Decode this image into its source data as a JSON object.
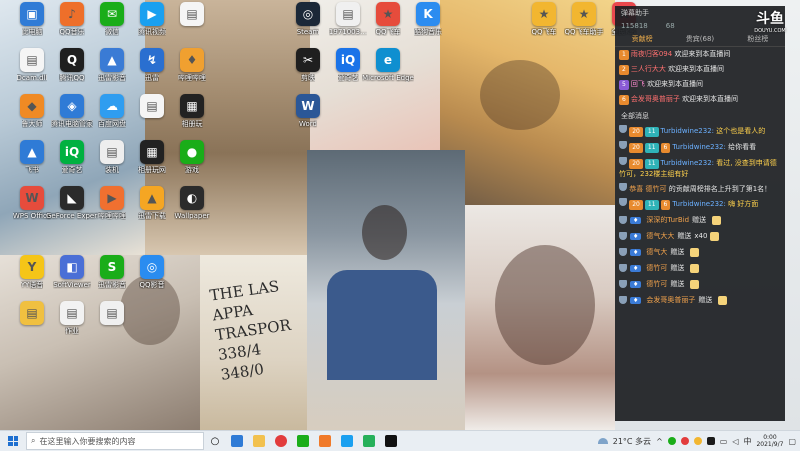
{
  "desktop": {
    "icons": [
      {
        "id": "d1",
        "label": "此电脑",
        "color": "#2f7bd6",
        "glyph": "▣"
      },
      {
        "id": "d2",
        "label": "QQ音乐",
        "color": "#ee6f2a",
        "glyph": "♪"
      },
      {
        "id": "d3",
        "label": "微信",
        "color": "#1aad19",
        "glyph": "✉"
      },
      {
        "id": "d4",
        "label": "腾讯视频",
        "color": "#1aa0f0",
        "glyph": "▶"
      },
      {
        "id": "d5",
        "label": "",
        "color": "#f5f5f5",
        "glyph": "▤"
      },
      {
        "id": "d6",
        "label": "Steam",
        "color": "#1b2838",
        "glyph": "◎"
      },
      {
        "id": "d7",
        "label": "1971003…",
        "color": "#f0f0f0",
        "glyph": "▤"
      },
      {
        "id": "d8",
        "label": "QQ飞车",
        "color": "#e64c3c",
        "glyph": "★"
      },
      {
        "id": "d9",
        "label": "酷狗音乐",
        "color": "#2c8cf0",
        "glyph": "K"
      },
      {
        "id": "d10",
        "label": "QQ飞车",
        "color": "#f2b630",
        "glyph": "★"
      },
      {
        "id": "d11",
        "label": "QQ飞车助手",
        "color": "#f2b630",
        "glyph": "★"
      },
      {
        "id": "d12",
        "label": "全民K歌",
        "color": "#e9484d",
        "glyph": "K"
      },
      {
        "id": "d13",
        "label": "Dcam.dll",
        "color": "#f5f5f5",
        "glyph": "▤"
      },
      {
        "id": "d14",
        "label": "腾讯QQ",
        "color": "#1f1f1f",
        "glyph": "Q"
      },
      {
        "id": "d15",
        "label": "迅雷影音",
        "color": "#3a7bd5",
        "glyph": "▲"
      },
      {
        "id": "d16",
        "label": "迅雷",
        "color": "#2a6fd0",
        "glyph": "↯"
      },
      {
        "id": "d17",
        "label": "哔哩哔哩",
        "color": "#f0a030",
        "glyph": "♦"
      },
      {
        "id": "d18",
        "label": "剪映",
        "color": "#1f1f1f",
        "glyph": "✂"
      },
      {
        "id": "d19",
        "label": "爱奇艺",
        "color": "#1a73e8",
        "glyph": "iQ"
      },
      {
        "id": "d20",
        "label": "Microsoft Edge",
        "color": "#0f8fd0",
        "glyph": "e"
      },
      {
        "id": "d21",
        "label": "鲁大师",
        "color": "#f08a24",
        "glyph": "◆"
      },
      {
        "id": "d22",
        "label": "腾讯电脑管家",
        "color": "#2f7bd6",
        "glyph": "◈"
      },
      {
        "id": "d23",
        "label": "百度网盘",
        "color": "#2f9df0",
        "glyph": "☁"
      },
      {
        "id": "d24",
        "label": "",
        "color": "#f5f5f5",
        "glyph": "▤"
      },
      {
        "id": "d25",
        "label": "相册玩",
        "color": "#222",
        "glyph": "▦"
      },
      {
        "id": "d26",
        "label": "Word",
        "color": "#2b5797",
        "glyph": "W"
      },
      {
        "id": "d27",
        "label": "飞书",
        "color": "#2f7bd6",
        "glyph": "▲"
      },
      {
        "id": "d28",
        "label": "爱奇艺",
        "color": "#00b140",
        "glyph": "iQ"
      },
      {
        "id": "d29",
        "label": "装机",
        "color": "#eee",
        "glyph": "▤"
      },
      {
        "id": "d30",
        "label": "相册玩网",
        "color": "#222",
        "glyph": "▦"
      },
      {
        "id": "d31",
        "label": "游戏",
        "color": "#1aad19",
        "glyph": "●"
      },
      {
        "id": "d32",
        "label": "WPS Office",
        "color": "#e64c3c",
        "glyph": "W"
      },
      {
        "id": "d33",
        "label": "GeForce Experience",
        "color": "#2b2b2b",
        "glyph": "◣"
      },
      {
        "id": "d34",
        "label": "哔哩哔哩",
        "color": "#f07030",
        "glyph": "▶"
      },
      {
        "id": "d35",
        "label": "迅雷下载",
        "color": "#f5a623",
        "glyph": "▲"
      },
      {
        "id": "d36",
        "label": "Wallpaper",
        "color": "#2b2b2b",
        "glyph": "◐"
      },
      {
        "id": "d37",
        "label": "YY语音",
        "color": "#f5c518",
        "glyph": "Y"
      },
      {
        "id": "d38",
        "label": "SoftViewer",
        "color": "#4a6fd6",
        "glyph": "◧"
      },
      {
        "id": "d39",
        "label": "迅雷影音",
        "color": "#1aad19",
        "glyph": "S"
      },
      {
        "id": "d40",
        "label": "QQ影音",
        "color": "#2a8cf0",
        "glyph": "◎"
      },
      {
        "id": "d41",
        "label": "",
        "color": "#f0c040",
        "glyph": "▤"
      },
      {
        "id": "d42",
        "label": "作业",
        "color": "#f2f2f2",
        "glyph": "▤"
      },
      {
        "id": "d43",
        "label": "",
        "color": "#f0f0f0",
        "glyph": "▤"
      }
    ]
  },
  "poster_lines": [
    "THE LAS",
    "APPA",
    "TRASPOR",
    "338/4",
    "348/0"
  ],
  "chat": {
    "header": "弹幕助手",
    "stats": [
      "115818",
      "68"
    ],
    "tabs": [
      "贡献榜",
      "贵宾(68)",
      "粉丝榜"
    ],
    "welcome_messages": [
      {
        "name": "雨夜归客094",
        "text": "欢迎来到本直播间",
        "name_class": "nm-red",
        "badge": "b-orange",
        "badge_text": "1"
      },
      {
        "name": "三人行大大",
        "text": "欢迎来到本直播间",
        "name_class": "nm-red",
        "badge": "b-orange",
        "badge_text": "2"
      },
      {
        "name": "回飞",
        "text": "欢迎来到本直播间",
        "name_class": "nm-pink",
        "badge": "b-purple",
        "badge_text": "5"
      },
      {
        "name": "会发哥奥普丽子",
        "text": "欢迎来到本直播间",
        "name_class": "nm-red",
        "badge": "b-orange",
        "badge_text": "6"
      }
    ],
    "section_title": "全部消息",
    "messages": [
      {
        "badges": [
          "b-orange:20",
          "b-teal:11"
        ],
        "name": "Turbidwine232:",
        "text": "这个也是看人的",
        "name_class": "nm-blue",
        "text_class": "txt-yellow"
      },
      {
        "badges": [
          "b-orange:20",
          "b-teal:11",
          "b-orange:6"
        ],
        "name": "Turbidwine232:",
        "text": "给你看看",
        "name_class": "nm-blue",
        "text_class": "txt-white"
      },
      {
        "badges": [
          "b-orange:20",
          "b-teal:11"
        ],
        "name": "Turbidwine232:",
        "text": "看过, 没查到申请德竹可，232楼主组有好",
        "name_class": "nm-blue",
        "text_class": "txt-yellow"
      },
      {
        "badges": [],
        "name": "恭喜 德竹可",
        "text": "的贡献周榜排名上升到了第1名！",
        "name_class": "nm-orange",
        "text_class": "txt-white"
      },
      {
        "badges": [
          "b-orange:20",
          "b-teal:11",
          "b-orange:6"
        ],
        "name": "Turbidwine232:",
        "text": "嗨 好方面",
        "name_class": "nm-blue",
        "text_class": "txt-yellow"
      }
    ],
    "gifts": [
      {
        "name": "深深的TurBid",
        "action": "赠送",
        "count": ""
      },
      {
        "name": "德气大大",
        "action": "赠送",
        "count": "x40"
      },
      {
        "name": "德气大",
        "action": "赠送",
        "count": ""
      },
      {
        "name": "德竹可",
        "action": "赠送",
        "count": ""
      },
      {
        "name": "德竹可",
        "action": "赠送",
        "count": ""
      },
      {
        "name": "会发哥奥普丽子",
        "action": "赠送",
        "count": ""
      }
    ],
    "watermark_main": "斗鱼",
    "watermark_sub": "DOUYU.COM"
  },
  "taskbar": {
    "search_placeholder": "在这里输入你要搜索的内容",
    "weather": "21°C 多云",
    "time": "0:00",
    "date": "2021/9/7"
  }
}
